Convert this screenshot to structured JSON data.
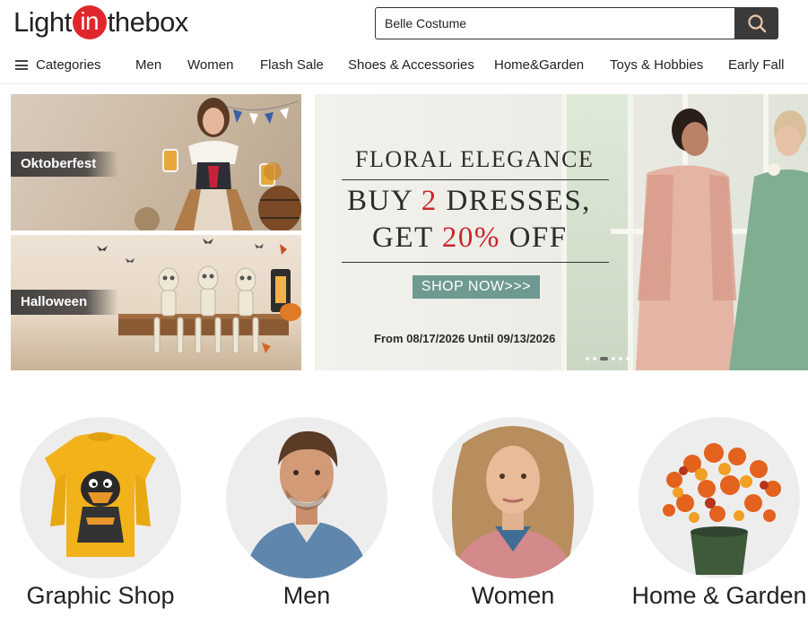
{
  "brand": {
    "logo_prefix": "Light",
    "logo_in": "in",
    "logo_suffix": "thebox"
  },
  "search": {
    "value": "Belle Costume",
    "placeholder": "Belle Costume"
  },
  "nav": {
    "categories_label": "Categories",
    "items": [
      "Men",
      "Women",
      "Flash Sale",
      "Shoes & Accessories",
      "Home&Garden",
      "Toys & Hobbies",
      "Early Fall"
    ]
  },
  "promos": {
    "oktoberfest": "Oktoberfest",
    "halloween": "Halloween"
  },
  "hero": {
    "title": "FLORAL ELEGANCE",
    "line1_pre": "BUY ",
    "line1_num": "2",
    "line1_post": " DRESSES,",
    "line2_pre": "GET ",
    "line2_num": "20%",
    "line2_post": " OFF",
    "cta": "SHOP NOW>>>",
    "dates": "From 08/17/2026 Until 09/13/2026",
    "slides": 5,
    "active_slide": 3
  },
  "categories": [
    {
      "label": "Graphic Shop"
    },
    {
      "label": "Men"
    },
    {
      "label": "Women"
    },
    {
      "label": "Home & Garden"
    }
  ],
  "colors": {
    "brand_red": "#e0272b",
    "offer_red": "#c8262b",
    "cta_teal": "#6e9a91",
    "search_btn": "#3a3a3a"
  }
}
